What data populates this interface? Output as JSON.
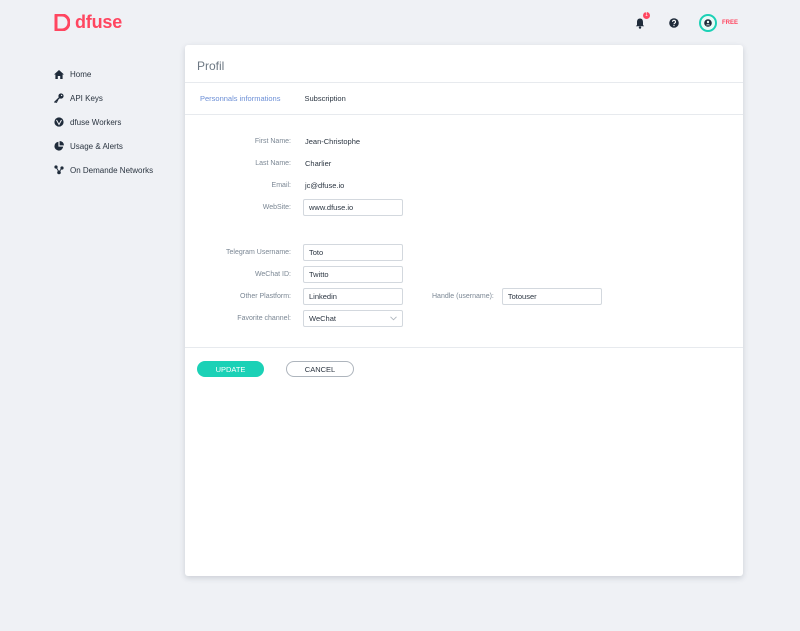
{
  "brand": {
    "name": "dfuse",
    "color": "#ff4660"
  },
  "header": {
    "notification_count": "1",
    "plan_label": "FREE",
    "icons": [
      "bell-icon",
      "help-icon",
      "user-icon"
    ]
  },
  "sidebar": {
    "items": [
      {
        "label": "Home",
        "icon": "home-icon"
      },
      {
        "label": "API Keys",
        "icon": "key-icon"
      },
      {
        "label": "dfuse Workers",
        "icon": "workers-icon"
      },
      {
        "label": "Usage & Alerts",
        "icon": "pie-chart-icon"
      },
      {
        "label": "On Demande Networks",
        "icon": "network-icon"
      }
    ]
  },
  "page": {
    "title": "Profil",
    "tabs": [
      {
        "label": "Personnals informations",
        "active": true
      },
      {
        "label": "Subscription",
        "active": false
      }
    ]
  },
  "profile": {
    "first_name": {
      "label": "First Name:",
      "value": "Jean-Christophe"
    },
    "last_name": {
      "label": "Last Name:",
      "value": "Charlier"
    },
    "email": {
      "label": "Email:",
      "value": "jc@dfuse.io"
    },
    "website": {
      "label": "WebSite:",
      "value": "www.dfuse.io"
    },
    "telegram": {
      "label": "Telegram Username:",
      "value": "Toto"
    },
    "wechat": {
      "label": "WeChat ID:",
      "value": "Twitto"
    },
    "other_platform": {
      "label": "Other Plastform:",
      "value": "Linkedin"
    },
    "handle": {
      "label": "Handle (username):",
      "value": "Totouser"
    },
    "favorite_channel": {
      "label": "Favorite channel:",
      "value": "WeChat"
    }
  },
  "actions": {
    "update_label": "UPDATE",
    "cancel_label": "CANCEL"
  },
  "colors": {
    "accent": "#1bd1b6",
    "tab_active": "#6c8fd6",
    "text": "#2b3541"
  }
}
